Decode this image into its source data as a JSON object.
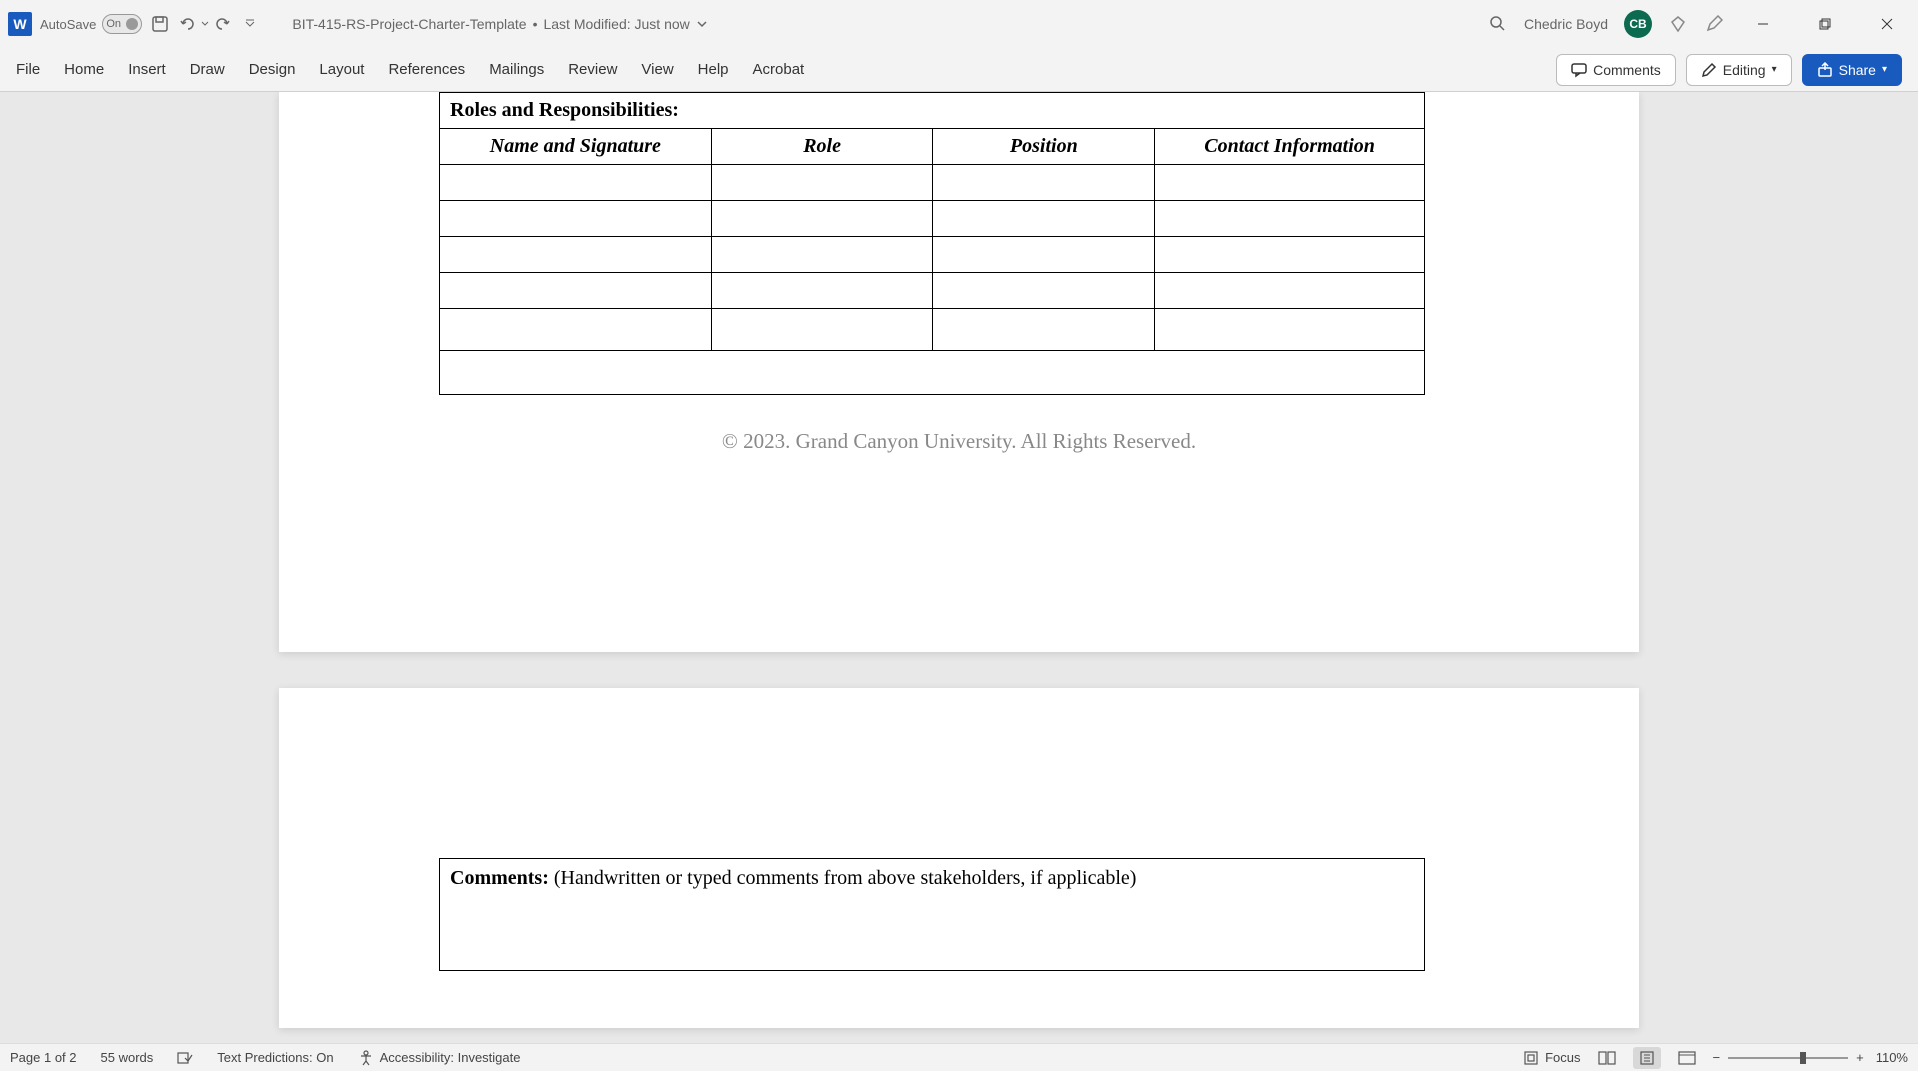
{
  "titlebar": {
    "autosave_label": "AutoSave",
    "autosave_state": "On",
    "doc_name": "BIT-415-RS-Project-Charter-Template",
    "modified_label": "Last Modified: Just now",
    "user_name": "Chedric Boyd",
    "user_initials": "CB"
  },
  "ribbon": {
    "tabs": [
      "File",
      "Home",
      "Insert",
      "Draw",
      "Design",
      "Layout",
      "References",
      "Mailings",
      "Review",
      "View",
      "Help",
      "Acrobat"
    ],
    "comments_btn": "Comments",
    "editing_btn": "Editing",
    "share_btn": "Share"
  },
  "document": {
    "roles_section_header": "Roles and Responsibilities:",
    "columns": {
      "name": "Name and Signature",
      "role": "Role",
      "position": "Position",
      "contact": "Contact Information"
    },
    "footer": "© 2023. Grand Canyon University. All Rights Reserved.",
    "comments_label": "Comments: ",
    "comments_hint": "(Handwritten or typed comments from above stakeholders, if applicable)"
  },
  "statusbar": {
    "page_info": "Page 1 of 2",
    "word_count": "55 words",
    "text_predictions": "Text Predictions: On",
    "accessibility": "Accessibility: Investigate",
    "focus": "Focus",
    "zoom": "110%"
  }
}
